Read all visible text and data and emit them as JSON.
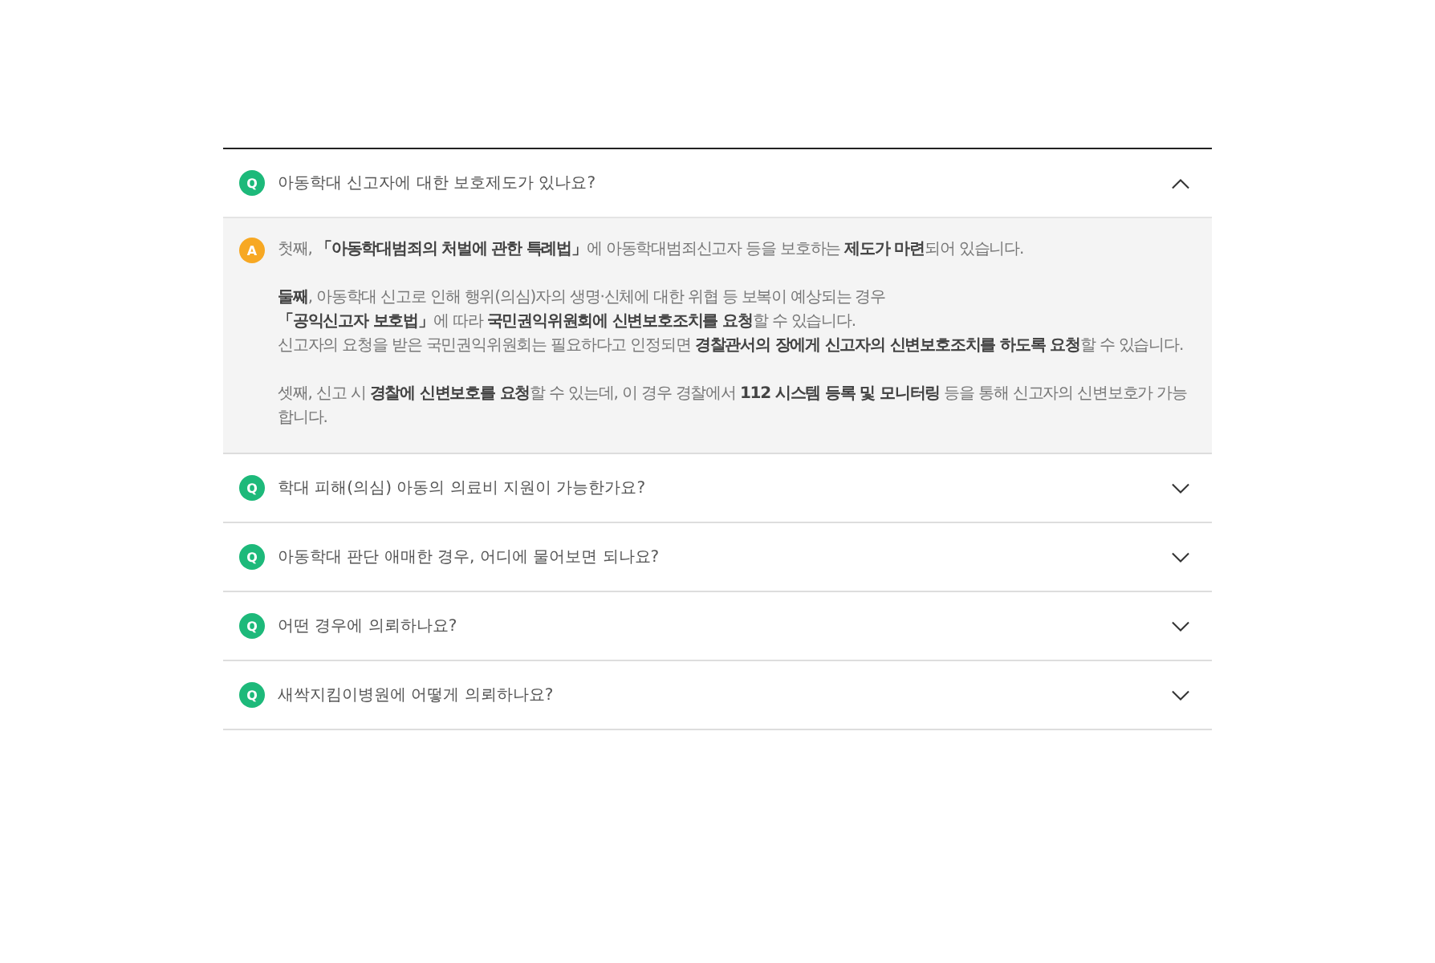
{
  "faq": [
    {
      "badge": "Q",
      "question": "아동학대 신고자에 대한 보호제도가 있나요?",
      "expanded": true,
      "answer": {
        "badge": "A",
        "paragraphs": [
          {
            "lines": [
              "첫째, **「아동학대범죄의 처벌에 관한 특례법」**에 아동학대범죄신고자 등을 보호하는 **제도가 마련**되어 있습니다."
            ]
          },
          {
            "lines": [
              "**둘째**, 아동학대 신고로 인해 행위(의심)자의 생명·신체에 대한 위협 등 보복이 예상되는 경우",
              "**「공익신고자 보호법」**에 따라 **국민권익위원회에 신변보호조치를 요청**할 수 있습니다.",
              "신고자의 요청을 받은 국민권익위원회는 필요하다고 인정되면 **경찰관서의 장에게 신고자의 신변보호조치를 하도록 요청**할 수 있습니다."
            ]
          },
          {
            "lines": [
              "셋째, 신고 시 **경찰에 신변보호를 요청**할 수 있는데, 이 경우 경찰에서 **112 시스템 등록 및 모니터링** 등을 통해 신고자의 신변보호가 가능합니다."
            ]
          }
        ]
      }
    },
    {
      "badge": "Q",
      "question": "학대 피해(의심) 아동의 의료비 지원이 가능한가요?",
      "expanded": false
    },
    {
      "badge": "Q",
      "question": "아동학대 판단 애매한 경우, 어디에 물어보면 되나요?",
      "expanded": false
    },
    {
      "badge": "Q",
      "question": "어떤 경우에 의뢰하나요?",
      "expanded": false
    },
    {
      "badge": "Q",
      "question": "새싹지킴이병원에 어떻게 의뢰하나요?",
      "expanded": false
    }
  ]
}
